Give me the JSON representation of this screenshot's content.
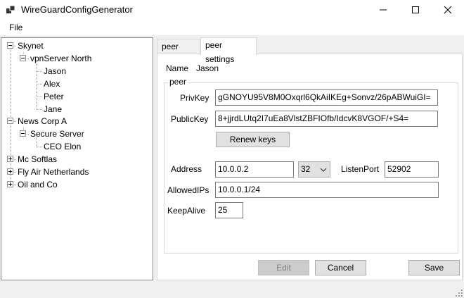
{
  "window": {
    "title": "WireGuardConfigGenerator"
  },
  "menu": {
    "file": "File"
  },
  "tree": {
    "nodes": [
      {
        "label": "Skynet"
      },
      {
        "label": "vpnServer North"
      },
      {
        "label": "Jason"
      },
      {
        "label": "Alex"
      },
      {
        "label": "Peter"
      },
      {
        "label": "Jane"
      },
      {
        "label": "News Corp A"
      },
      {
        "label": "Secure Server"
      },
      {
        "label": "CEO Elon"
      },
      {
        "label": "Mc Softlas"
      },
      {
        "label": "Fly Air Netherlands"
      },
      {
        "label": "Oil and Co"
      }
    ]
  },
  "tabs": [
    {
      "label": "peer conf"
    },
    {
      "label": "peer settings"
    }
  ],
  "peer": {
    "name_label": "Name",
    "name_value": "Jason",
    "group_title": "peer",
    "privkey_label": "PrivKey",
    "privkey_value": "gGNOYU95V8M0Oxqrl6QkAiIKEg+Sonvz/26pABWuiGI=",
    "publickey_label": "PublicKey",
    "publickey_value": "8+jjrdLUtq2I7uEa8VlstZBFIOfb/IdcvK8VGOF/+S4=",
    "renew_keys": "Renew keys",
    "address_label": "Address",
    "address_value": "10.0.0.2",
    "mask_value": "32",
    "listenport_label": "ListenPort",
    "listenport_value": "52902",
    "allowedips_label": "AllowedIPs",
    "allowedips_value": "10.0.0.1/24",
    "keepalive_label": "KeepAlive",
    "keepalive_value": "25"
  },
  "actions": {
    "edit": "Edit",
    "cancel": "Cancel",
    "save": "Save"
  },
  "colors": {
    "border": "#828790",
    "button_face": "#e1e1e1",
    "disabled_text": "#838383"
  }
}
